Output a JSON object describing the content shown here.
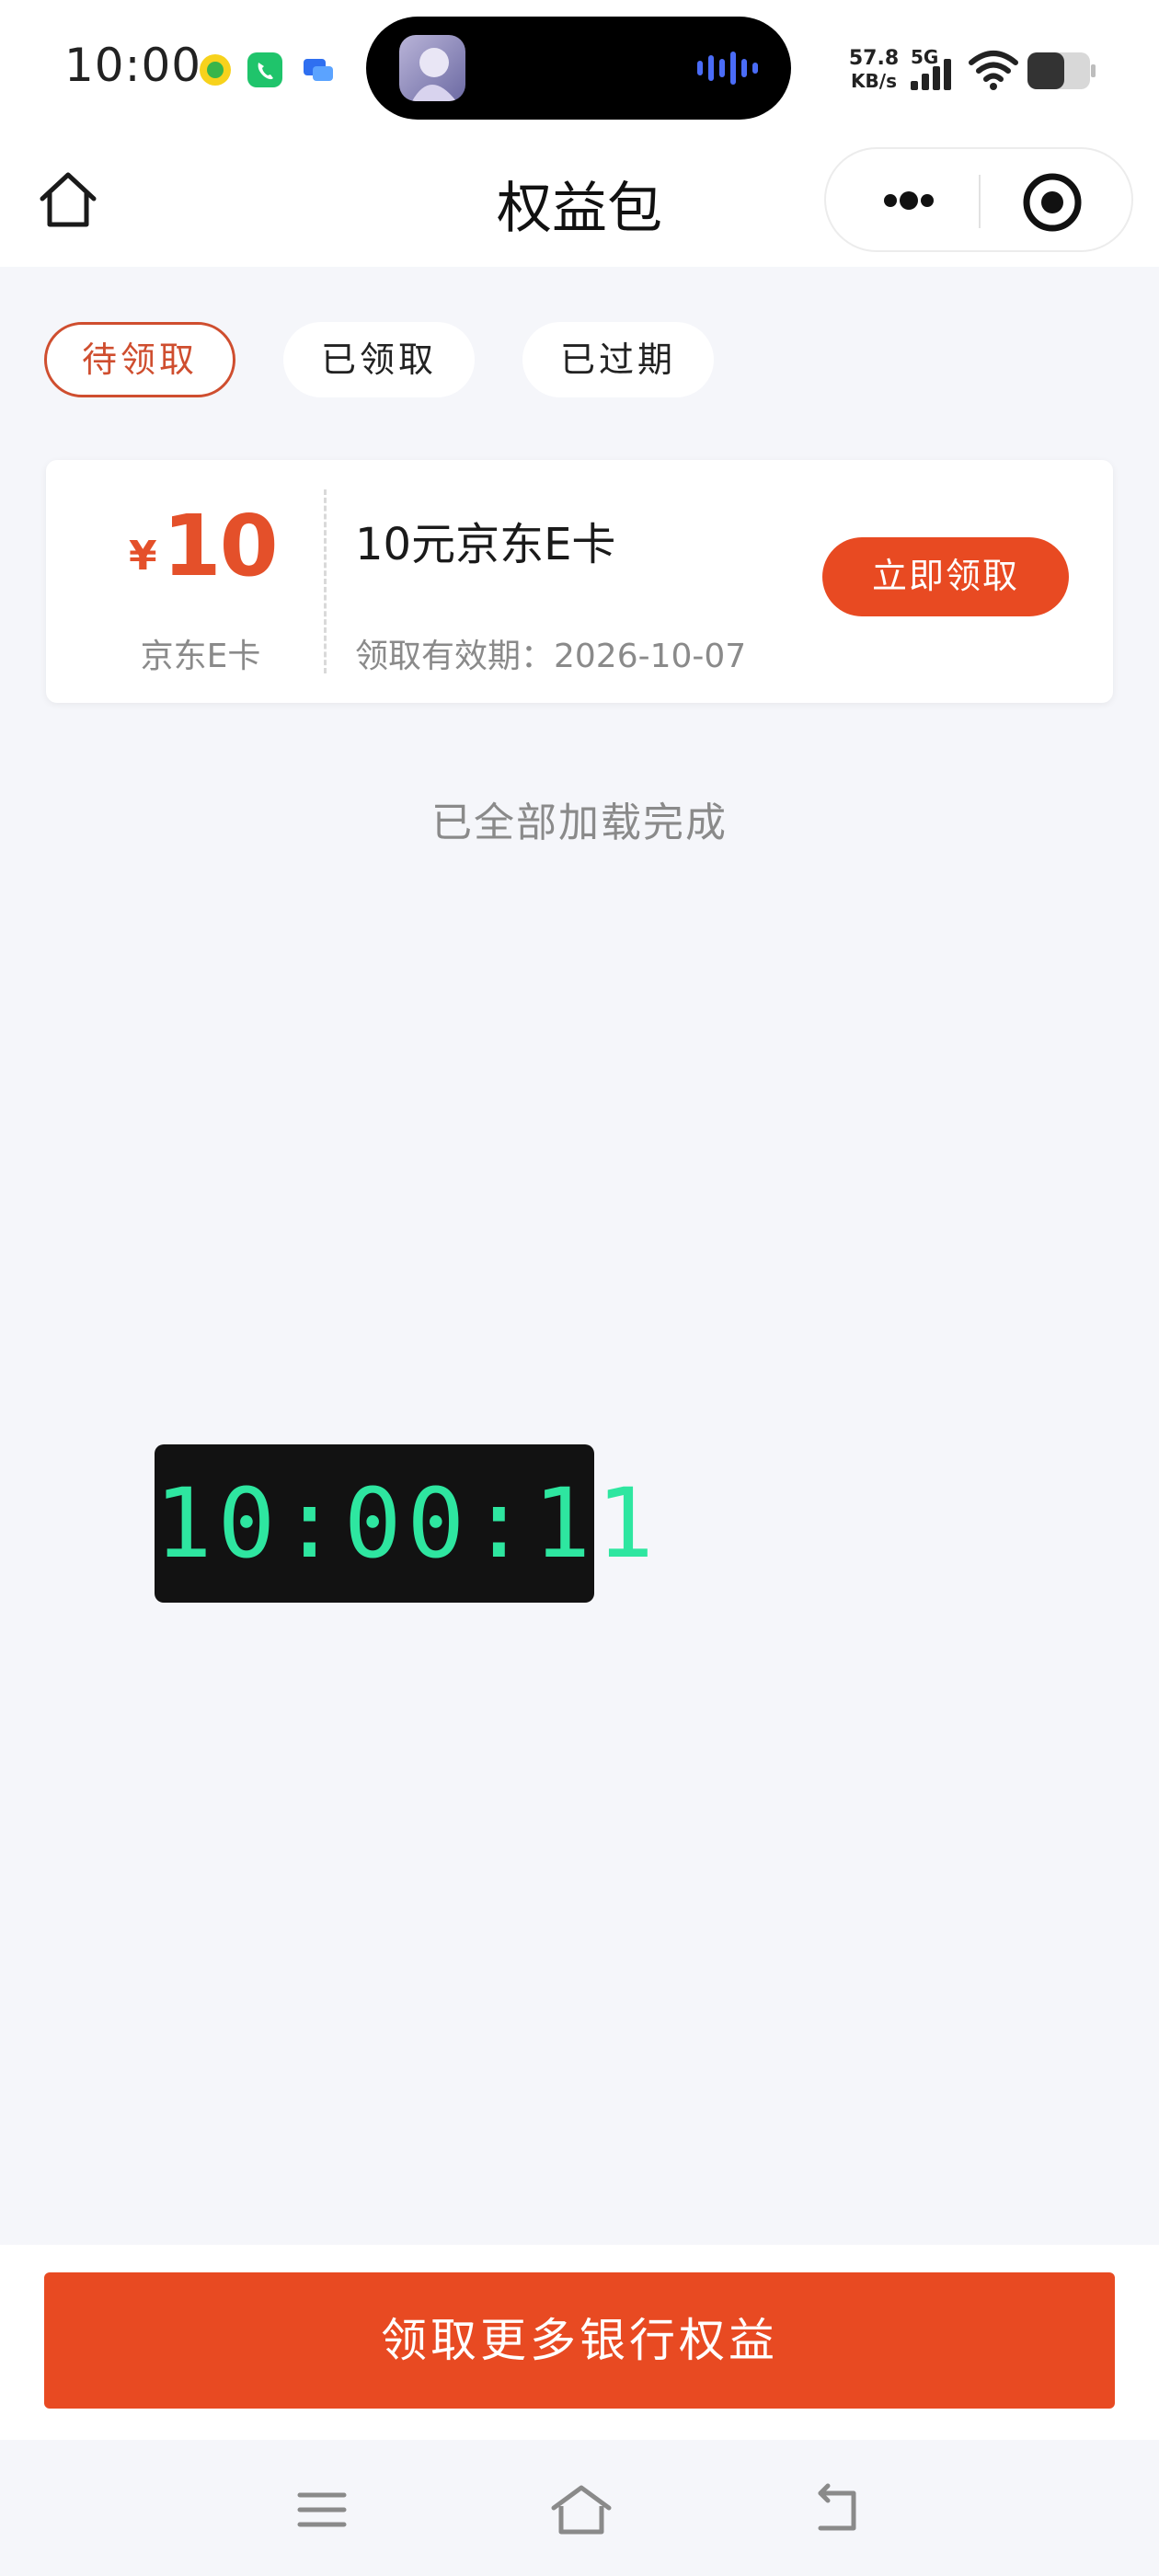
{
  "status_bar": {
    "time": "10:00",
    "net_speed_value": "57.8",
    "net_speed_unit": "KB/s",
    "network_type": "5G"
  },
  "nav": {
    "title": "权益包"
  },
  "tabs": [
    {
      "label": "待领取",
      "active": true
    },
    {
      "label": "已领取",
      "active": false
    },
    {
      "label": "已过期",
      "active": false
    }
  ],
  "coupon": {
    "currency": "¥",
    "amount": "10",
    "type": "京东E卡",
    "title": "10元京东E卡",
    "validity": "领取有效期：2026-10-07",
    "claim_label": "立即领取"
  },
  "list_footer": "已全部加载完成",
  "clock": "10:00:11",
  "bottom": {
    "more_rights_label": "领取更多银行权益"
  },
  "icons": {
    "home": "home-icon",
    "more": "more-dots-icon",
    "close": "target-close-icon",
    "menu": "menu-icon",
    "sys_home": "system-home-icon",
    "back": "back-icon"
  },
  "colors": {
    "accent": "#e84a22",
    "tab_active": "#cf4e2f",
    "clock_digits": "#2ee6a0"
  }
}
